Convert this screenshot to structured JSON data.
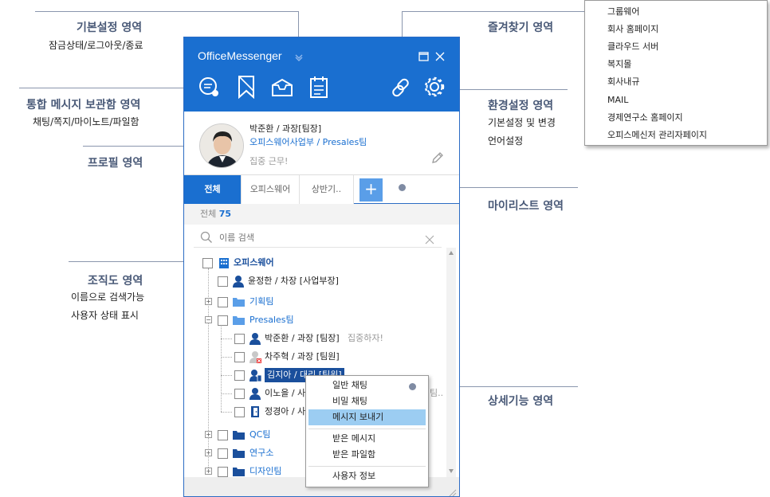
{
  "annotations": {
    "basic": {
      "title": "기본설정 영역",
      "sub": "잠금상태/로그아웃/종료"
    },
    "inbox": {
      "title": "통합 메시지 보관함 영역",
      "sub": "채팅/쪽지/마이노트/파일함"
    },
    "profile": {
      "title": "프로필 영역"
    },
    "org": {
      "title": "조직도 영역",
      "sub1": "이름으로 검색가능",
      "sub2": "사용자 상태 표시"
    },
    "favorites": {
      "title": "즐겨찾기 영역"
    },
    "settings": {
      "title": "환경설정 영역",
      "sub1": "기본설정 및 변경",
      "sub2": "언어설정"
    },
    "mylist": {
      "title": "마이리스트 영역"
    },
    "detail": {
      "title": "상세기능 영역"
    }
  },
  "window": {
    "title": "OfficeMessenger",
    "icons": [
      "chat-bubble-icon",
      "note-icon",
      "inbox-tray-icon",
      "calendar-icon",
      "link-icon",
      "gear-icon",
      "minimize-icon",
      "maximize-icon",
      "close-icon"
    ]
  },
  "profile": {
    "name": "박준환 / 과장[팀장]",
    "dept": "오피스웨어사업부 / Presales팀",
    "status_message": "집중 근무!"
  },
  "tabs": [
    {
      "label": "전체",
      "active": true
    },
    {
      "label": "오피스웨어",
      "active": false
    },
    {
      "label": "상반기..",
      "active": false
    }
  ],
  "tab_add_label": "+",
  "count": {
    "label": "전체",
    "value": "75"
  },
  "search": {
    "placeholder": "이름 검색"
  },
  "tree": {
    "root": "오피스웨어",
    "rows": [
      {
        "label": "윤정한 / 차장 [사업부장]"
      },
      {
        "label": "기획팀"
      },
      {
        "label": "Presales팀"
      },
      {
        "label": "박준환 / 과장 [팀장]",
        "status": "집중하자!"
      },
      {
        "label": "차주혁 / 과장 [팀원]"
      },
      {
        "label": "김지아 / 대리 [팀원]"
      },
      {
        "label": "이노을 / 사",
        "status": "팀.."
      },
      {
        "label": "정경아 / 사"
      },
      {
        "label": "QC팀"
      },
      {
        "label": "연구소"
      },
      {
        "label": "디자인팀"
      }
    ]
  },
  "context_menu": {
    "items": [
      "일반 채팅",
      "비밀 채팅",
      "메시지 보내기",
      "받은 메시지",
      "받은 파일함",
      "사용자 정보"
    ],
    "selected": "메시지 보내기"
  },
  "favorites_menu": {
    "items": [
      "그룹웨어",
      "회사 홈페이지",
      "클라우드 서버",
      "복지몰",
      "회사내규",
      "MAIL",
      "경제연구소 홈페이지",
      "오피스메신저 관리자페이지"
    ]
  },
  "colors": {
    "brand": "#1a6fd0",
    "annotation": "#4a5a78",
    "selection": "#9ccdf2"
  }
}
